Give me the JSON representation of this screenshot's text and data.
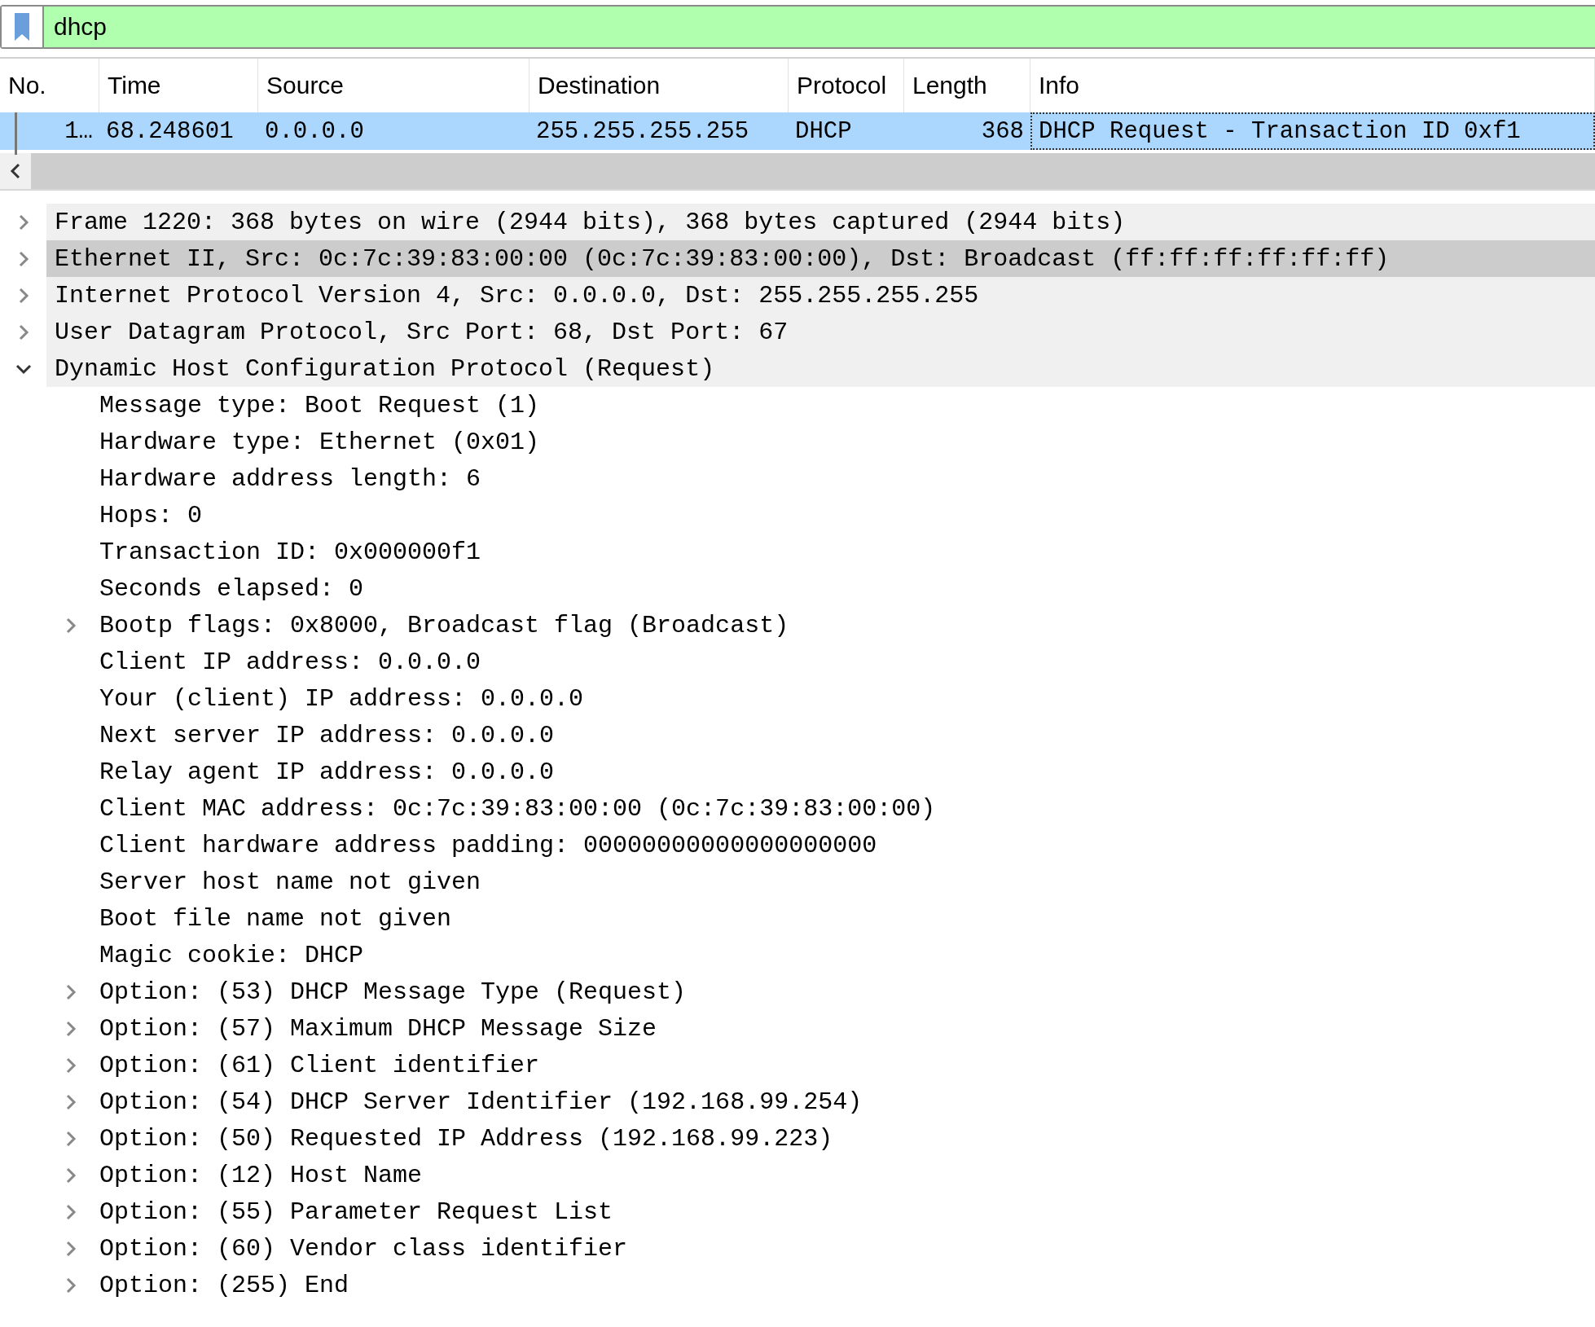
{
  "filter": {
    "value": "dhcp"
  },
  "packet_list": {
    "columns": [
      "No.",
      "Time",
      "Source",
      "Destination",
      "Protocol",
      "Length",
      "Info"
    ],
    "rows": [
      {
        "selected": true,
        "cells": [
          "1…",
          "68.248601",
          "0.0.0.0",
          "255.255.255.255",
          "DHCP",
          "368",
          "DHCP Request  - Transaction ID 0xf1"
        ]
      }
    ]
  },
  "details": [
    {
      "kind": "branch",
      "expanded": false,
      "selected": false,
      "text": "Frame 1220: 368 bytes on wire (2944 bits), 368 bytes captured (2944 bits)"
    },
    {
      "kind": "branch",
      "expanded": false,
      "selected": true,
      "text": "Ethernet II, Src: 0c:7c:39:83:00:00 (0c:7c:39:83:00:00), Dst: Broadcast (ff:ff:ff:ff:ff:ff)"
    },
    {
      "kind": "branch",
      "expanded": false,
      "selected": false,
      "text": "Internet Protocol Version 4, Src: 0.0.0.0, Dst: 255.255.255.255"
    },
    {
      "kind": "branch",
      "expanded": false,
      "selected": false,
      "text": "User Datagram Protocol, Src Port: 68, Dst Port: 67"
    },
    {
      "kind": "branch",
      "expanded": true,
      "selected": false,
      "text": "Dynamic Host Configuration Protocol (Request)",
      "children": [
        {
          "kind": "leaf",
          "selected": false,
          "text": "Message type: Boot Request (1)"
        },
        {
          "kind": "leaf",
          "selected": false,
          "text": "Hardware type: Ethernet (0x01)"
        },
        {
          "kind": "leaf",
          "selected": false,
          "text": "Hardware address length: 6"
        },
        {
          "kind": "leaf",
          "selected": false,
          "text": "Hops: 0"
        },
        {
          "kind": "leaf",
          "selected": false,
          "text": "Transaction ID: 0x000000f1"
        },
        {
          "kind": "leaf",
          "selected": false,
          "text": "Seconds elapsed: 0"
        },
        {
          "kind": "branch",
          "expanded": false,
          "selected": false,
          "text": "Bootp flags: 0x8000, Broadcast flag (Broadcast)"
        },
        {
          "kind": "leaf",
          "selected": false,
          "text": "Client IP address: 0.0.0.0"
        },
        {
          "kind": "leaf",
          "selected": false,
          "text": "Your (client) IP address: 0.0.0.0"
        },
        {
          "kind": "leaf",
          "selected": false,
          "text": "Next server IP address: 0.0.0.0"
        },
        {
          "kind": "leaf",
          "selected": false,
          "text": "Relay agent IP address: 0.0.0.0"
        },
        {
          "kind": "leaf",
          "selected": false,
          "text": "Client MAC address: 0c:7c:39:83:00:00 (0c:7c:39:83:00:00)"
        },
        {
          "kind": "leaf",
          "selected": false,
          "text": "Client hardware address padding: 00000000000000000000"
        },
        {
          "kind": "leaf",
          "selected": false,
          "text": "Server host name not given"
        },
        {
          "kind": "leaf",
          "selected": false,
          "text": "Boot file name not given"
        },
        {
          "kind": "leaf",
          "selected": false,
          "text": "Magic cookie: DHCP"
        },
        {
          "kind": "branch",
          "expanded": false,
          "selected": false,
          "text": "Option: (53) DHCP Message Type (Request)"
        },
        {
          "kind": "branch",
          "expanded": false,
          "selected": false,
          "text": "Option: (57) Maximum DHCP Message Size"
        },
        {
          "kind": "branch",
          "expanded": false,
          "selected": false,
          "text": "Option: (61) Client identifier"
        },
        {
          "kind": "branch",
          "expanded": false,
          "selected": false,
          "text": "Option: (54) DHCP Server Identifier (192.168.99.254)"
        },
        {
          "kind": "branch",
          "expanded": false,
          "selected": false,
          "text": "Option: (50) Requested IP Address (192.168.99.223)"
        },
        {
          "kind": "branch",
          "expanded": false,
          "selected": false,
          "text": "Option: (12) Host Name"
        },
        {
          "kind": "branch",
          "expanded": false,
          "selected": false,
          "text": "Option: (55) Parameter Request List"
        },
        {
          "kind": "branch",
          "expanded": false,
          "selected": false,
          "text": "Option: (60) Vendor class identifier"
        },
        {
          "kind": "branch",
          "expanded": false,
          "selected": false,
          "text": "Option: (255) End"
        }
      ]
    }
  ]
}
